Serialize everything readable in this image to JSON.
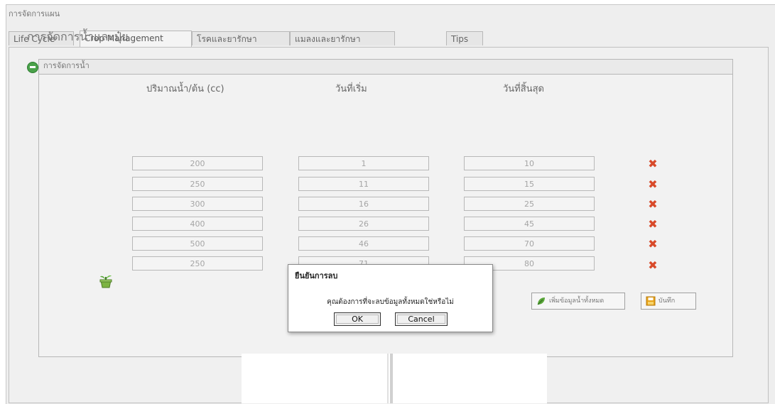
{
  "window": {
    "title": "การจัดการแผน"
  },
  "tabs": [
    {
      "label": "Life Cycle"
    },
    {
      "label": "Crop Management"
    },
    {
      "label": "โรคและยารักษา"
    },
    {
      "label": "แมลงและยารักษา"
    },
    {
      "label": "Tips"
    }
  ],
  "section": {
    "title": "การจัดการน้ำและปุ๋ย"
  },
  "group": {
    "title": "การจัดการน้ำ"
  },
  "table": {
    "headers": [
      "ปริมาณน้ำ/ต้น (cc)",
      "วันที่เริ่ม",
      "วันที่สิ้นสุด"
    ],
    "rows": [
      [
        "200",
        "1",
        "10"
      ],
      [
        "250",
        "11",
        "15"
      ],
      [
        "300",
        "16",
        "25"
      ],
      [
        "400",
        "26",
        "45"
      ],
      [
        "500",
        "46",
        "70"
      ],
      [
        "250",
        "71",
        "80"
      ]
    ]
  },
  "buttons": {
    "add_data": "เพิ่มข้อมูลน้ำทั้งหมด",
    "save": "บันทึก"
  },
  "dialog": {
    "title": "ยืนยันการลบ",
    "message": "คุณต้องการที่จะลบข้อมูลทั้งหมดใช่หรือไม่",
    "ok": "OK",
    "cancel": "Cancel"
  },
  "icons": {
    "delete": "close-x-icon",
    "collapse": "collapse-toggle-icon",
    "add_row": "plant-pot-icon",
    "add_data": "leaf-icon",
    "save": "floppy-disk-icon"
  },
  "colors": {
    "delete": "#d84a2a",
    "toggle": "#4aa14a"
  }
}
